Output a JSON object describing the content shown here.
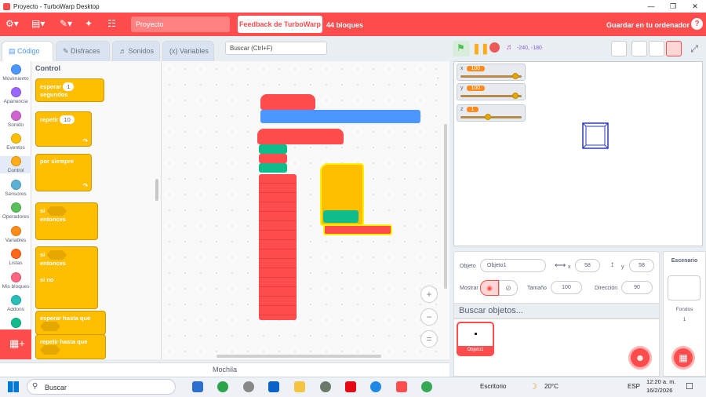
{
  "window": {
    "title": "Proyecto - TurboWarp Desktop",
    "app_icon": "turbowarp-icon"
  },
  "menubar": {
    "project_name": "Proyecto",
    "feedback_label": "Feedback de TurboWarp",
    "block_count": "44 bloques",
    "save_label": "Guardar en tu ordenador",
    "help": "?"
  },
  "tabs": {
    "code": "Código",
    "costumes": "Disfraces",
    "sounds": "Sonidos",
    "variables": "Variables"
  },
  "search": {
    "placeholder": "Buscar (Ctrl+F)"
  },
  "categories": [
    {
      "label": "Movimiento",
      "color": "#4c97ff"
    },
    {
      "label": "Apariencia",
      "color": "#9966ff"
    },
    {
      "label": "Sonido",
      "color": "#cf63cf"
    },
    {
      "label": "Eventos",
      "color": "#ffbf00"
    },
    {
      "label": "Control",
      "color": "#ffab19"
    },
    {
      "label": "Sensores",
      "color": "#5cb1d6"
    },
    {
      "label": "Operadores",
      "color": "#59c059"
    },
    {
      "label": "Variables",
      "color": "#ff8c1a"
    },
    {
      "label": "Listas",
      "color": "#ff661a"
    },
    {
      "label": "Mis bloques",
      "color": "#ff6680"
    },
    {
      "label": "Addons",
      "color": "#29beb8"
    },
    {
      "label": "",
      "color": "#0fbd8c"
    }
  ],
  "palette": {
    "heading": "Control",
    "wait_label": "esperar",
    "wait_value": "1",
    "wait_unit": "segundos",
    "repeat_label": "repetir",
    "repeat_value": "10",
    "forever_label": "por siempre",
    "if_label": "si",
    "then_label": "entonces",
    "if2_label": "si",
    "then2_label": "entonces",
    "else_label": "si no",
    "wait_until_label": "esperar hasta que",
    "repeat_until_label": "repetir hasta que"
  },
  "stage": {
    "coords": "-240, -180",
    "monitors": [
      {
        "name": "x",
        "value": "100",
        "slider_fraction": 0.9
      },
      {
        "name": "y",
        "value": "100",
        "slider_fraction": 0.9
      },
      {
        "name": "z",
        "value": "1",
        "slider_fraction": 0.45
      }
    ]
  },
  "sprite_info": {
    "sprite_label": "Objeto",
    "sprite_name": "Objeto1",
    "x_label": "x",
    "x_value": "58",
    "y_label": "y",
    "y_value": "58",
    "show_label": "Mostrar",
    "size_label": "Tamaño",
    "size_value": "100",
    "direction_label": "Dirección",
    "direction_value": "90"
  },
  "sprite_search": {
    "placeholder": "Buscar objetos..."
  },
  "sprites": [
    {
      "name": "Objeto1"
    }
  ],
  "stage_panel": {
    "title": "Escenario",
    "backdrops_label": "Fondos",
    "backdrops_count": "1"
  },
  "backpack": {
    "label": "Mochila"
  },
  "taskbar": {
    "search_label": "Buscar",
    "desktop_label": "Escritorio",
    "temperature": "20°C",
    "language": "ESP",
    "time": "12:20 a. m.",
    "date": "16/2/2026"
  }
}
